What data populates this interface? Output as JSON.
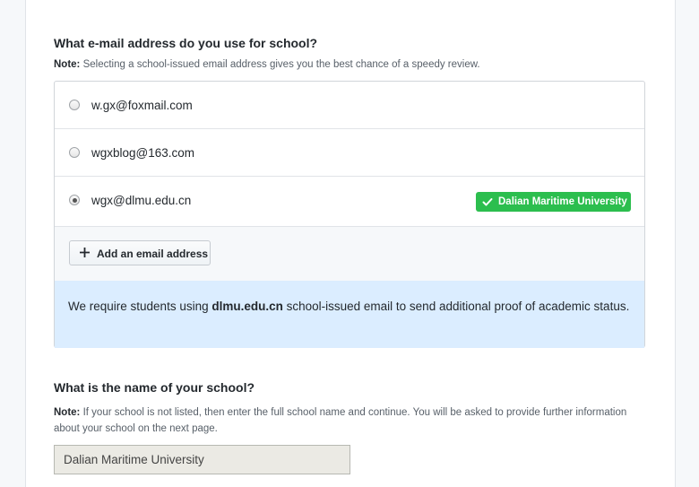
{
  "email_question": {
    "title": "What e-mail address do you use for school?",
    "note_label": "Note:",
    "note_text": "Selecting a school-issued email address gives you the best chance of a speedy review."
  },
  "emails": [
    {
      "address": "w.gx@foxmail.com",
      "selected": false
    },
    {
      "address": "wgxblog@163.com",
      "selected": false
    },
    {
      "address": "wgx@dlmu.edu.cn",
      "selected": true,
      "badge": "Dalian Maritime University"
    }
  ],
  "add_email_button": {
    "label": "Add an email address",
    "icon": "plus-icon"
  },
  "info_box": {
    "prefix": "We require students using ",
    "domain": "dlmu.edu.cn",
    "suffix": " school-issued email to send additional proof of academic status."
  },
  "school_question": {
    "title": "What is the name of your school?",
    "note_label": "Note:",
    "note_text": "If your school is not listed, then enter the full school name and continue. You will be asked to provide further information about your school on the next page.",
    "value": "Dalian Maritime University"
  },
  "colors": {
    "badge_green": "#2cbe4e",
    "info_blue": "#dbedff"
  }
}
